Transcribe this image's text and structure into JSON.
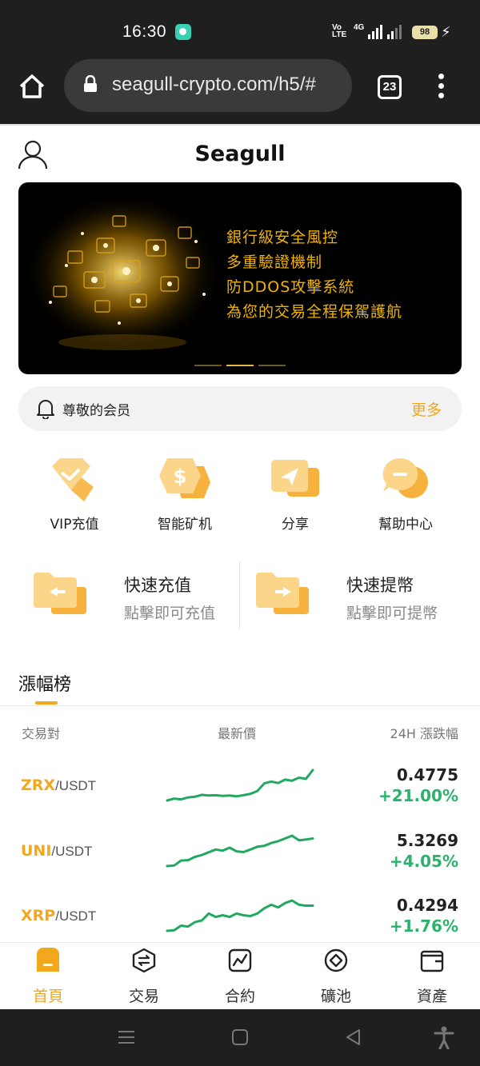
{
  "status_bar": {
    "time": "16:30",
    "volte": "Vo\nLTE",
    "network": "4G",
    "battery": "98"
  },
  "browser": {
    "url": "seagull-crypto.com/h5/#",
    "tab_count": "23"
  },
  "app": {
    "title": "Seagull"
  },
  "banner": {
    "lines": [
      "銀行級安全風控",
      "多重驗證機制",
      "防DDOS攻擊系統",
      "為您的交易全程保駕護航"
    ],
    "slides": 3,
    "active_slide": 1
  },
  "notice": {
    "message": "尊敬的会员",
    "more_label": "更多"
  },
  "quick_menu": [
    {
      "label": "VIP充值",
      "icon": "diamond-icon"
    },
    {
      "label": "智能矿机",
      "icon": "coin-icon"
    },
    {
      "label": "分享",
      "icon": "share-icon"
    },
    {
      "label": "幫助中心",
      "icon": "help-icon"
    }
  ],
  "fast_actions": [
    {
      "title": "快速充值",
      "subtitle": "點擊即可充值",
      "icon": "deposit-folder-icon"
    },
    {
      "title": "快速提幣",
      "subtitle": "點擊即可提幣",
      "icon": "withdraw-folder-icon"
    }
  ],
  "ranking": {
    "tab_label": "漲幅榜",
    "columns": [
      "交易對",
      "最新價",
      "24H 漲跌幅"
    ],
    "rows": [
      {
        "base": "ZRX",
        "quote": "/USDT",
        "price": "0.4775",
        "change": "+21.00%",
        "spark": [
          4,
          5,
          4.6,
          5.6,
          6,
          7,
          6.6,
          6.8,
          6.4,
          6.6,
          6.2,
          6.8,
          7.5,
          9,
          13,
          14,
          13.2,
          15,
          14.4,
          16,
          15.4,
          20
        ]
      },
      {
        "base": "UNI",
        "quote": "/USDT",
        "price": "5.3269",
        "change": "+4.05%",
        "spark": [
          2,
          2.3,
          5,
          5.2,
          7,
          8,
          9.5,
          11,
          10.4,
          12,
          10,
          9.6,
          11,
          12.5,
          13,
          14.5,
          15.5,
          17,
          18.5,
          16,
          16.4,
          17
        ]
      },
      {
        "base": "XRP",
        "quote": "/USDT",
        "price": "0.4294",
        "change": "+1.76%",
        "spark": [
          2,
          2.3,
          5,
          4.5,
          7,
          8,
          12,
          10,
          11,
          10,
          12,
          11,
          10.5,
          12,
          15,
          17,
          15.5,
          18,
          19.5,
          17,
          16.5,
          16.5
        ]
      }
    ]
  },
  "bottom_nav": [
    {
      "label": "首頁",
      "icon": "home-icon",
      "active": true
    },
    {
      "label": "交易",
      "icon": "exchange-icon",
      "active": false
    },
    {
      "label": "合約",
      "icon": "chart-icon",
      "active": false
    },
    {
      "label": "礦池",
      "icon": "pool-icon",
      "active": false
    },
    {
      "label": "資產",
      "icon": "wallet-icon",
      "active": false
    }
  ],
  "colors": {
    "accent": "#f2a81d",
    "up": "#29b36b",
    "spark_line": "#22a860",
    "banner_text": "#f0b400"
  }
}
